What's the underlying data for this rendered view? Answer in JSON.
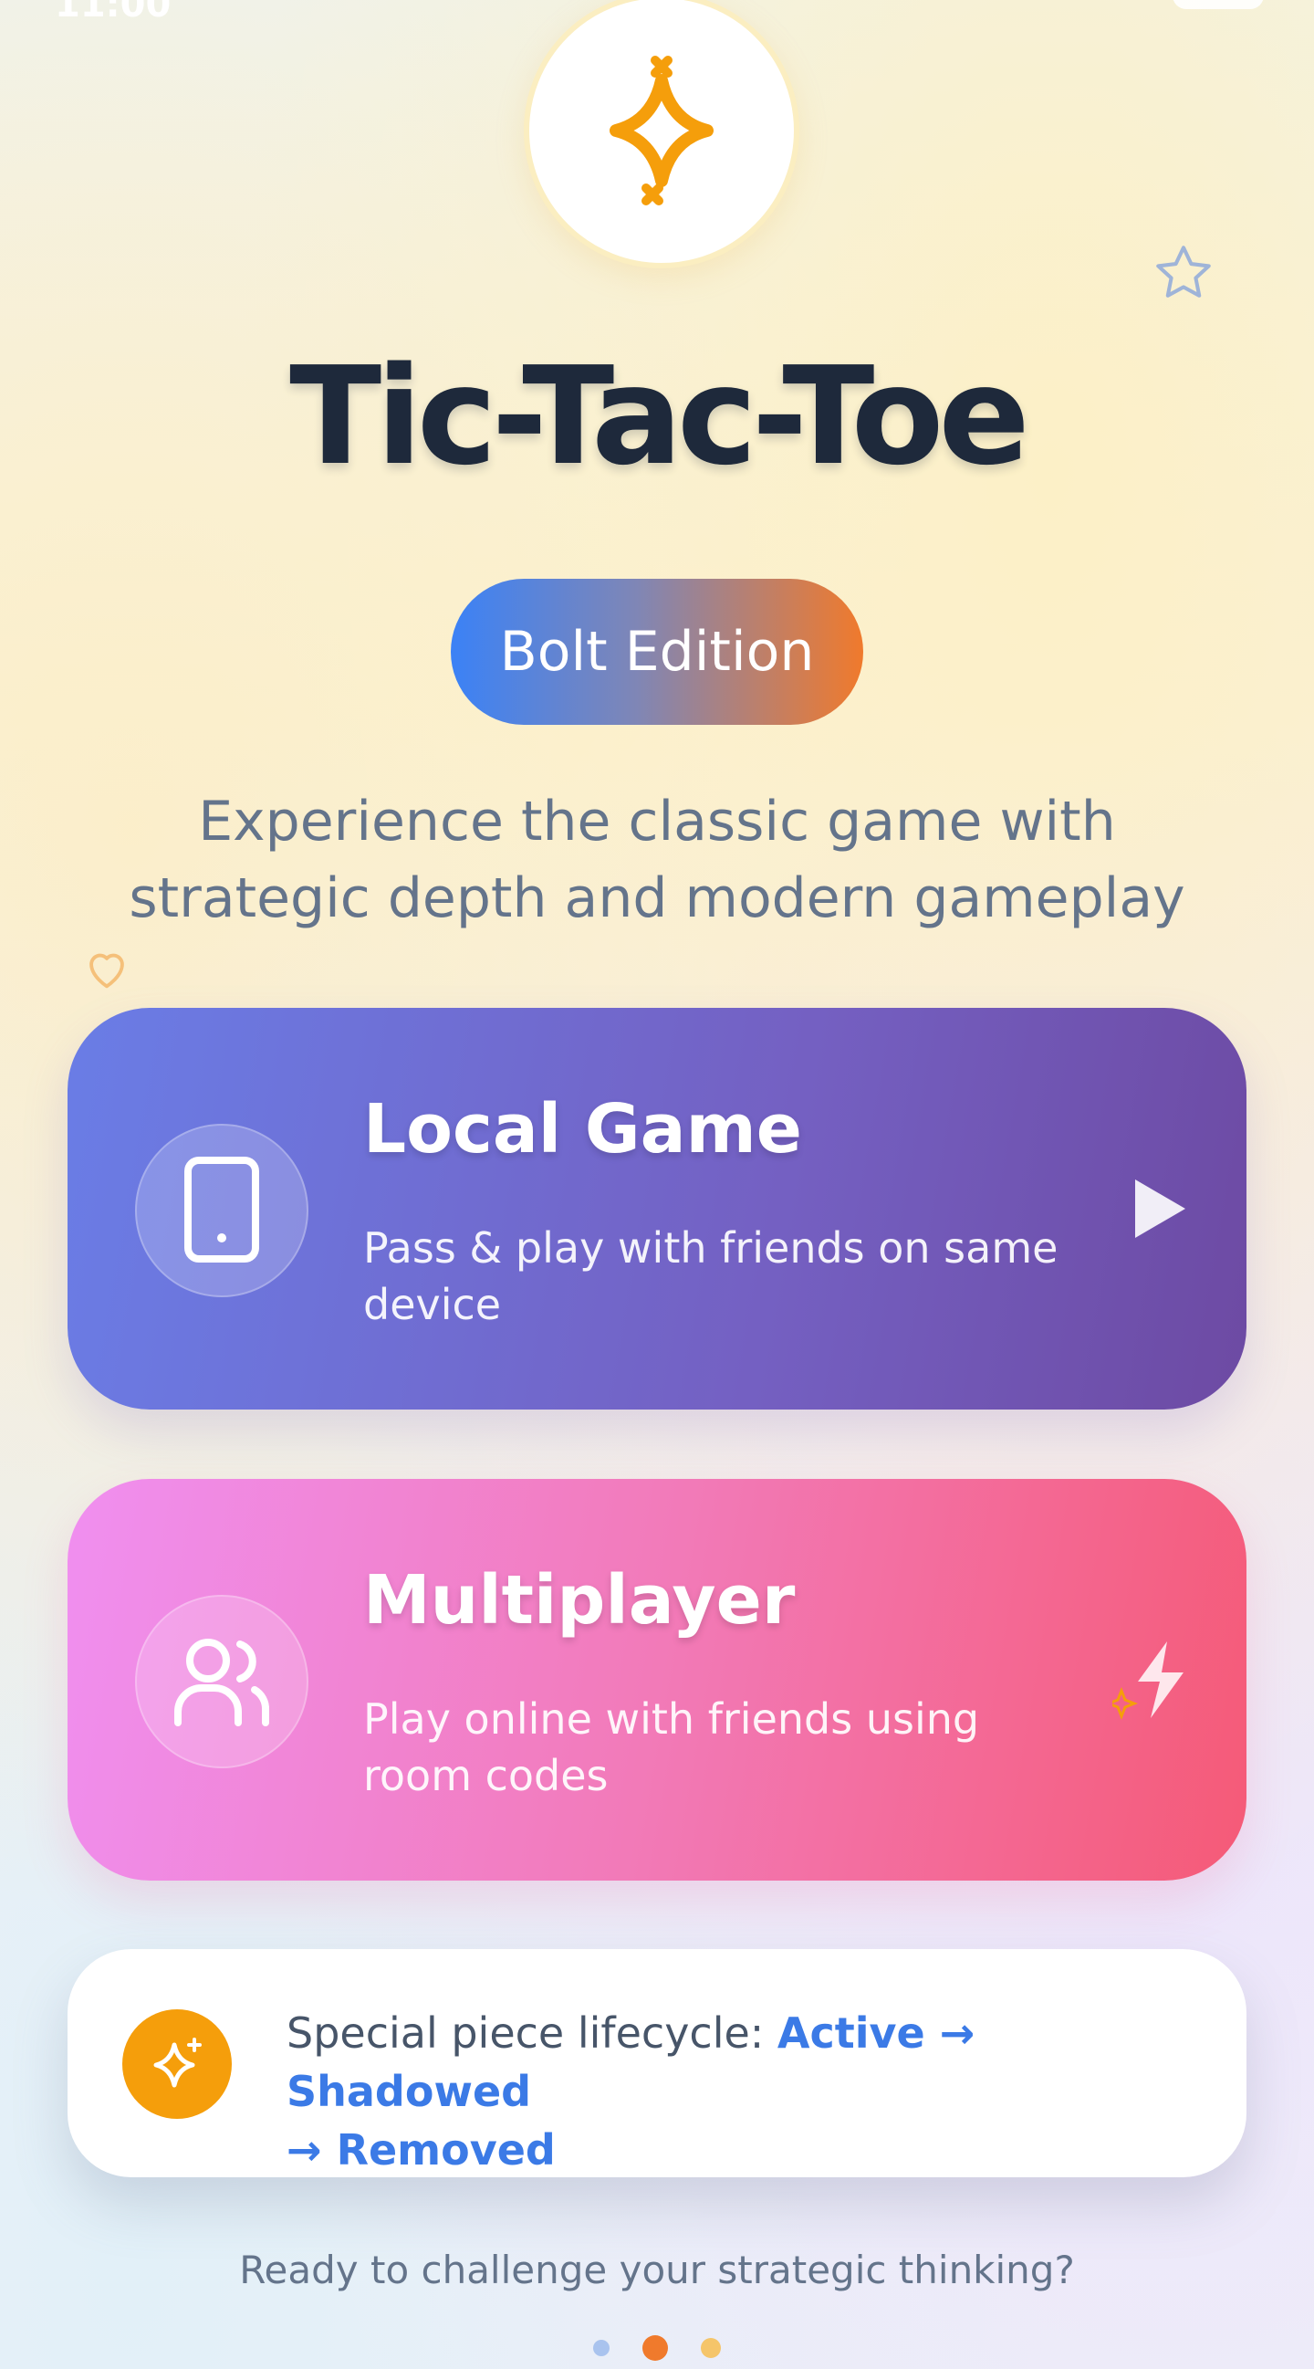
{
  "status_bar": {
    "time_partial": "11:00"
  },
  "app": {
    "title": "Tic-Tac-Toe",
    "badge": "Bolt Edition",
    "subtitle": "Experience the classic game with strategic depth and modern gameplay"
  },
  "cards": {
    "local": {
      "title": "Local Game",
      "description": "Pass & play with friends on same device",
      "icon": "tablet-icon",
      "action_icon": "play-icon"
    },
    "multiplayer": {
      "title": "Multiplayer",
      "description": "Play online with friends using room codes",
      "icon": "users-icon",
      "action_icon": "lightning-icon"
    }
  },
  "info": {
    "prefix": "Special piece lifecycle: ",
    "state_active": "Active",
    "arrow1": " → ",
    "state_shadowed": "Shadowed",
    "arrow2": "→ ",
    "state_removed": "Removed",
    "icon": "sparkle-icon"
  },
  "footer": {
    "tagline": "Ready to challenge your strategic thinking?"
  },
  "colors": {
    "title": "#1e293b",
    "badge_start": "#3b82f6",
    "badge_end": "#f07a2c",
    "local_card": "#6a7de6",
    "multiplayer_card": "#f27ab8",
    "highlight": "#3b7ae6",
    "info_icon_bg": "#f59e0b"
  },
  "pagination": {
    "total": 3,
    "active_index": 1
  }
}
